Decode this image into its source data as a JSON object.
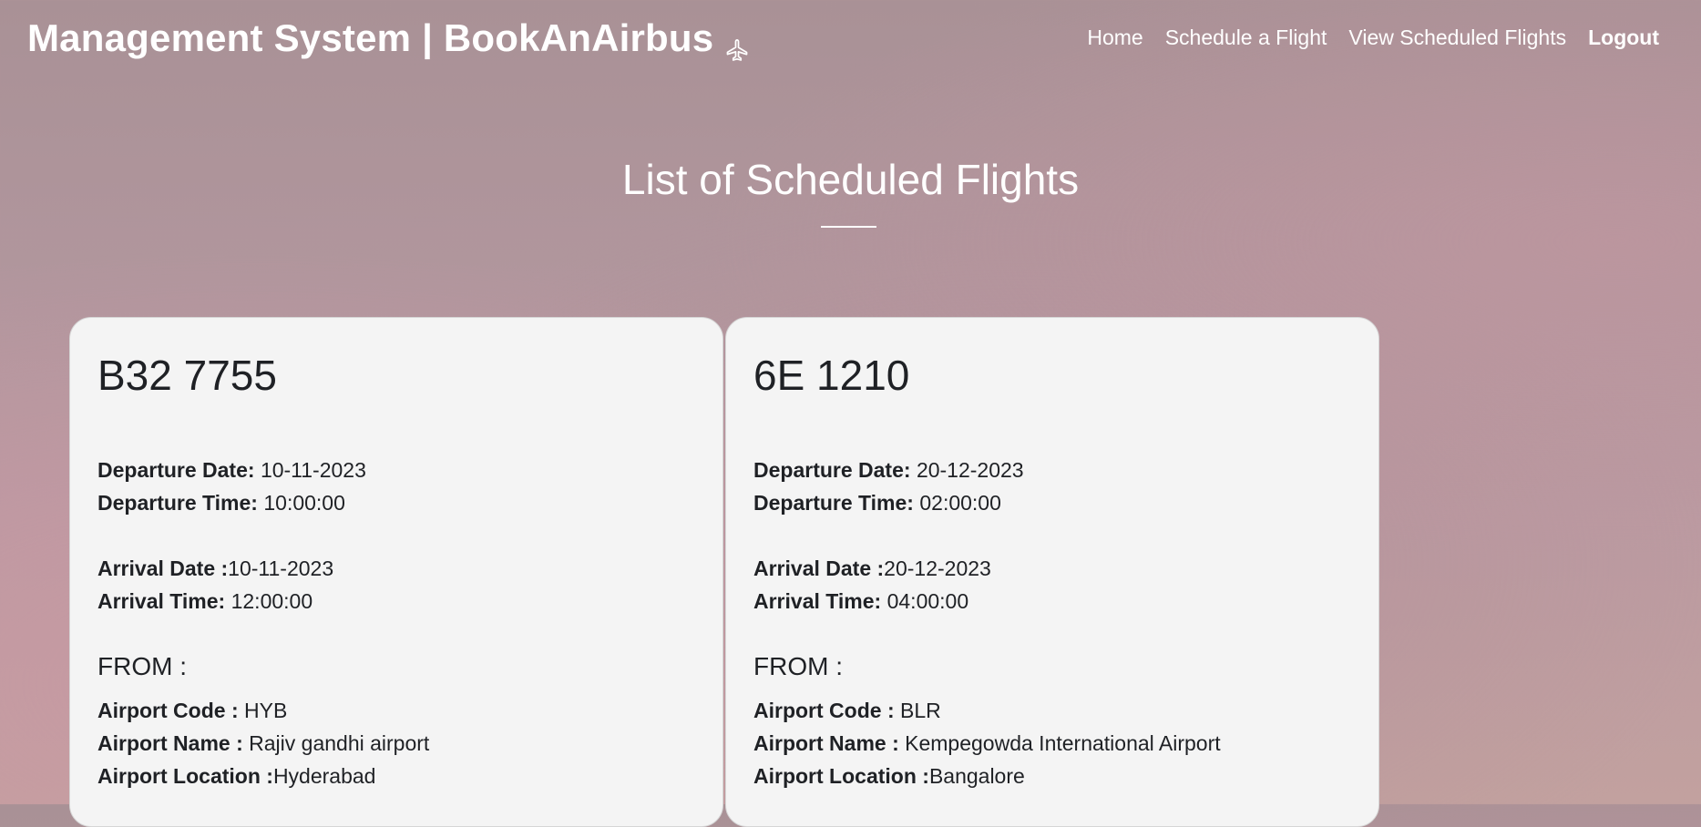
{
  "navbar": {
    "brand": "Management System | BookAnAirbus",
    "links": [
      {
        "label": "Home"
      },
      {
        "label": "Schedule a Flight"
      },
      {
        "label": "View Scheduled Flights"
      },
      {
        "label": "Logout"
      }
    ]
  },
  "page": {
    "title": "List of Scheduled Flights"
  },
  "labels": {
    "departure_date": "Departure Date:",
    "departure_time": "Departure Time:",
    "arrival_date": "Arrival Date :",
    "arrival_time": "Arrival Time:",
    "from": "FROM :",
    "airport_code": "Airport Code :",
    "airport_name": "Airport Name :",
    "airport_location": "Airport Location :"
  },
  "flights": [
    {
      "flight_number": "B32 7755",
      "departure_date": "10-11-2023",
      "departure_time": "10:00:00",
      "arrival_date": "10-11-2023",
      "arrival_time": "12:00:00",
      "from": {
        "airport_code": "HYB",
        "airport_name": "Rajiv gandhi airport",
        "airport_location": "Hyderabad"
      }
    },
    {
      "flight_number": "6E 1210",
      "departure_date": "20-12-2023",
      "departure_time": "02:00:00",
      "arrival_date": "20-12-2023",
      "arrival_time": "04:00:00",
      "from": {
        "airport_code": "BLR",
        "airport_name": "Kempegowda International Airport",
        "airport_location": "Bangalore"
      }
    }
  ],
  "icons": {
    "brand_icon": "airplane-icon"
  }
}
